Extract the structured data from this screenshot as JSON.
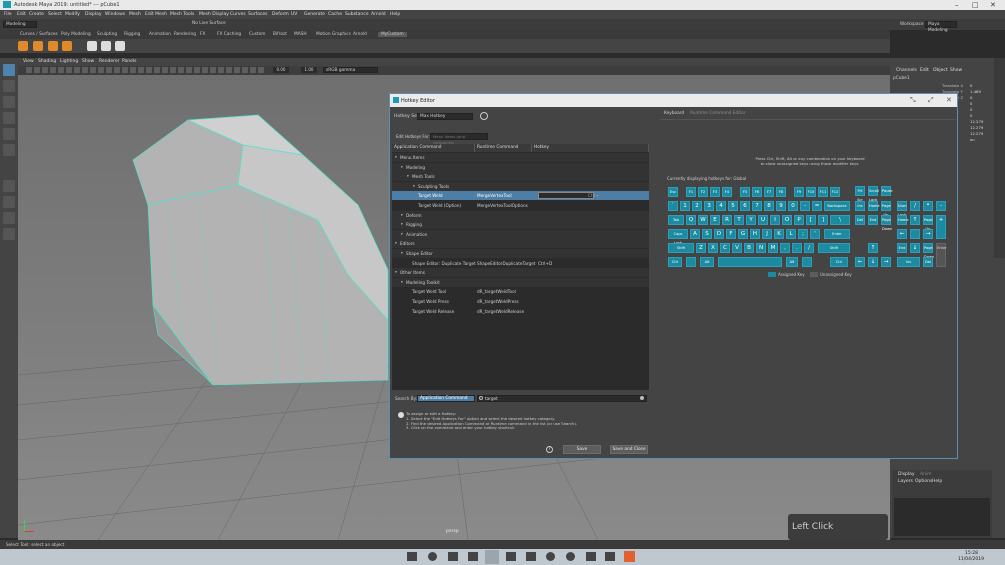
{
  "app_title": "Autodesk Maya 2019: untitled*  ---  pCube1",
  "menus": [
    "File",
    "Edit",
    "Create",
    "Select",
    "Modify",
    "Display",
    "Windows",
    "Mesh",
    "Edit Mesh",
    "Mesh Tools",
    "Mesh Display",
    "Curves",
    "Surfaces",
    "Deform",
    "UV",
    "Generate",
    "Cache",
    "Substance",
    "Arnold",
    "Help"
  ],
  "status": {
    "mode": "Modeling",
    "live_surface": "No Live Surface",
    "workspace_label": "Workspace :",
    "workspace": "Maya Modeling"
  },
  "shelf_tabs": [
    "Curves / Surfaces",
    "Poly Modeling",
    "Sculpting",
    "Rigging",
    "Animation",
    "Rendering",
    "FX",
    "FX Caching",
    "Custom",
    "Bifrost",
    "MASH",
    "Motion Graphics",
    "Arnold",
    "MyCustom"
  ],
  "viewport": {
    "menu": [
      "View",
      "Shading",
      "Lighting",
      "Show",
      "Renderer",
      "Panels"
    ],
    "exposure": "0.00",
    "gamma": "1.00",
    "color_space": "sRGB gamma",
    "camera_label": "persp"
  },
  "channel_box": {
    "tabs": [
      "Channels",
      "Edit",
      "Object",
      "Show"
    ],
    "object": "pCube1",
    "rows": [
      {
        "label": "Translate X",
        "value": "0"
      },
      {
        "label": "Translate Y",
        "value": "1.489"
      },
      {
        "label": "Translate Z",
        "value": "0"
      },
      {
        "label": "Rotate X",
        "value": "0"
      },
      {
        "label": "Rotate Y",
        "value": "0"
      },
      {
        "label": "Rotate Z",
        "value": "0"
      },
      {
        "label": "Scale X",
        "value": "12.279"
      },
      {
        "label": "Scale Y",
        "value": "12.279"
      },
      {
        "label": "Scale Z",
        "value": "12.279"
      },
      {
        "label": "Visibility",
        "value": "on"
      }
    ],
    "layer_tabs": [
      "Display",
      "Anim"
    ],
    "layer_menu": [
      "Layers",
      "Options",
      "Help"
    ]
  },
  "hotkey_editor": {
    "title": "Hotkey Editor",
    "hotkey_set_label": "Hotkey Set:",
    "hotkey_set": "Max Hotkey",
    "edit_for_label": "Edit Hotkeys For:",
    "edit_for": "Menu items (and categories)",
    "columns": [
      "Application Command",
      "Runtime Command",
      "Hotkey"
    ],
    "rows": [
      {
        "indent": 0,
        "type": "group",
        "app": "Menu Items",
        "runtime": "",
        "hotkey": ""
      },
      {
        "indent": 1,
        "type": "group",
        "app": "Modeling",
        "runtime": "",
        "hotkey": ""
      },
      {
        "indent": 2,
        "type": "group",
        "app": "Mesh Tools",
        "runtime": "",
        "hotkey": ""
      },
      {
        "indent": 3,
        "type": "group",
        "app": "Sculpting Tools",
        "runtime": "",
        "hotkey": ""
      },
      {
        "indent": 3,
        "type": "sel",
        "app": "Target Weld",
        "runtime": "MergeVertexTool",
        "hotkey": "Ctrl+"
      },
      {
        "indent": 3,
        "type": "item",
        "app": "Target Weld (Option)",
        "runtime": "MergeVertexToolOptions",
        "hotkey": ""
      },
      {
        "indent": 1,
        "type": "group",
        "app": "Deform",
        "runtime": "",
        "hotkey": ""
      },
      {
        "indent": 1,
        "type": "group",
        "app": "Rigging",
        "runtime": "",
        "hotkey": ""
      },
      {
        "indent": 1,
        "type": "group",
        "app": "Animation",
        "runtime": "",
        "hotkey": ""
      },
      {
        "indent": 0,
        "type": "group",
        "app": "Editors",
        "runtime": "",
        "hotkey": ""
      },
      {
        "indent": 1,
        "type": "group",
        "app": "Shape Editor",
        "runtime": "",
        "hotkey": ""
      },
      {
        "indent": 2,
        "type": "item",
        "app": "Shape Editor: Duplicate Target",
        "runtime": "ShapeEditorDuplicateTarget",
        "hotkey": "Ctrl+D"
      },
      {
        "indent": 0,
        "type": "group",
        "app": "Other Items",
        "runtime": "",
        "hotkey": ""
      },
      {
        "indent": 1,
        "type": "group",
        "app": "Modeling Toolkit",
        "runtime": "",
        "hotkey": ""
      },
      {
        "indent": 2,
        "type": "item",
        "app": "Target Weld Tool",
        "runtime": "dR_targetWeldTool",
        "hotkey": ""
      },
      {
        "indent": 2,
        "type": "item",
        "app": "Target Weld Press",
        "runtime": "dR_targetWeldPress",
        "hotkey": ""
      },
      {
        "indent": 2,
        "type": "item",
        "app": "Target Weld Release",
        "runtime": "dR_targetWeldRelease",
        "hotkey": ""
      }
    ],
    "search_label": "Search By:",
    "search_by": "Application Command",
    "search_text": "target",
    "help_lines": [
      "To assign or edit a Hotkey:",
      "1. Select the \"Edit Hotkeys For\" option and select the desired hotkey category.",
      "2. Find the desired Application Command or Runtime command in the list (or use Search).",
      "3. Click on the command and enter your hotkey shortcut."
    ],
    "save_label": "Save",
    "save_close_label": "Save and Close",
    "right_tabs": [
      "Keyboard",
      "Runtime Command Editor"
    ],
    "keyboard_hint": "Press Ctrl, Shift, Alt or any combination on your keyboard to show unassigned keys using those modifier keys.",
    "displaying": "Currently displaying hotkeys for: Global",
    "legend_assigned": "Assigned Key",
    "legend_unassigned": "Unassigned Key"
  },
  "overlay": {
    "left_click": "Left Click"
  },
  "help_line": "Select Tool: select an object",
  "clock": {
    "time": "15:28",
    "date": "11/04/2019"
  }
}
